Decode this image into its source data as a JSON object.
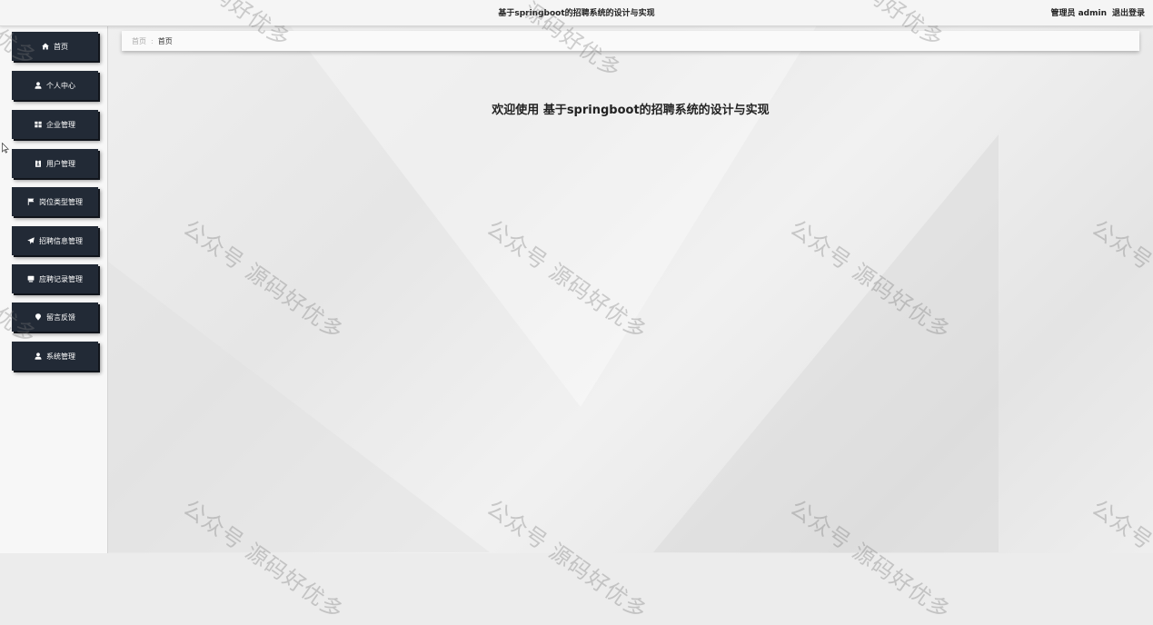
{
  "header": {
    "title": "基于springboot的招聘系统的设计与实现",
    "user_label": "管理员 admin",
    "logout_label": "退出登录"
  },
  "sidebar": {
    "items": [
      {
        "label": "首页",
        "icon": "home-icon"
      },
      {
        "label": "个人中心",
        "icon": "user-icon"
      },
      {
        "label": "企业管理",
        "icon": "grid-icon"
      },
      {
        "label": "用户管理",
        "icon": "id-card-icon"
      },
      {
        "label": "岗位类型管理",
        "icon": "flag-icon"
      },
      {
        "label": "招聘信息管理",
        "icon": "paper-plane-icon"
      },
      {
        "label": "应聘记录管理",
        "icon": "monitor-icon"
      },
      {
        "label": "留言反馈",
        "icon": "map-pin-icon"
      },
      {
        "label": "系统管理",
        "icon": "user-icon"
      }
    ]
  },
  "breadcrumb": {
    "home": "首页",
    "separator": ":",
    "current": "首页"
  },
  "main": {
    "welcome": "欢迎使用 基于springboot的招聘系统的设计与实现"
  },
  "watermark": {
    "text": "公众号 源码好优多",
    "fragment_top": "源码好优多",
    "fragment_left": "优多"
  },
  "colors": {
    "sidebar_button": "#222a36",
    "topbar": "#f5f5f5"
  }
}
